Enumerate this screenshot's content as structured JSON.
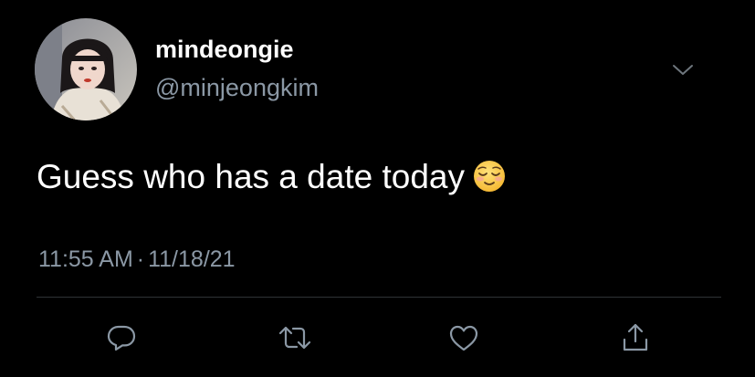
{
  "author": {
    "display_name": "mindeongie",
    "handle": "@minjeongkim"
  },
  "tweet": {
    "text": "Guess who has a date today",
    "emoji": "relieved-face-emoji",
    "time": "11:55 AM",
    "separator": "·",
    "date": "11/18/21"
  },
  "actions": [
    {
      "icon": "reply-icon"
    },
    {
      "icon": "retweet-icon"
    },
    {
      "icon": "like-icon"
    },
    {
      "icon": "share-icon"
    }
  ],
  "colors": {
    "background": "#000000",
    "text": "#ffffff",
    "muted": "#8b98a5",
    "divider": "#2f3336"
  }
}
